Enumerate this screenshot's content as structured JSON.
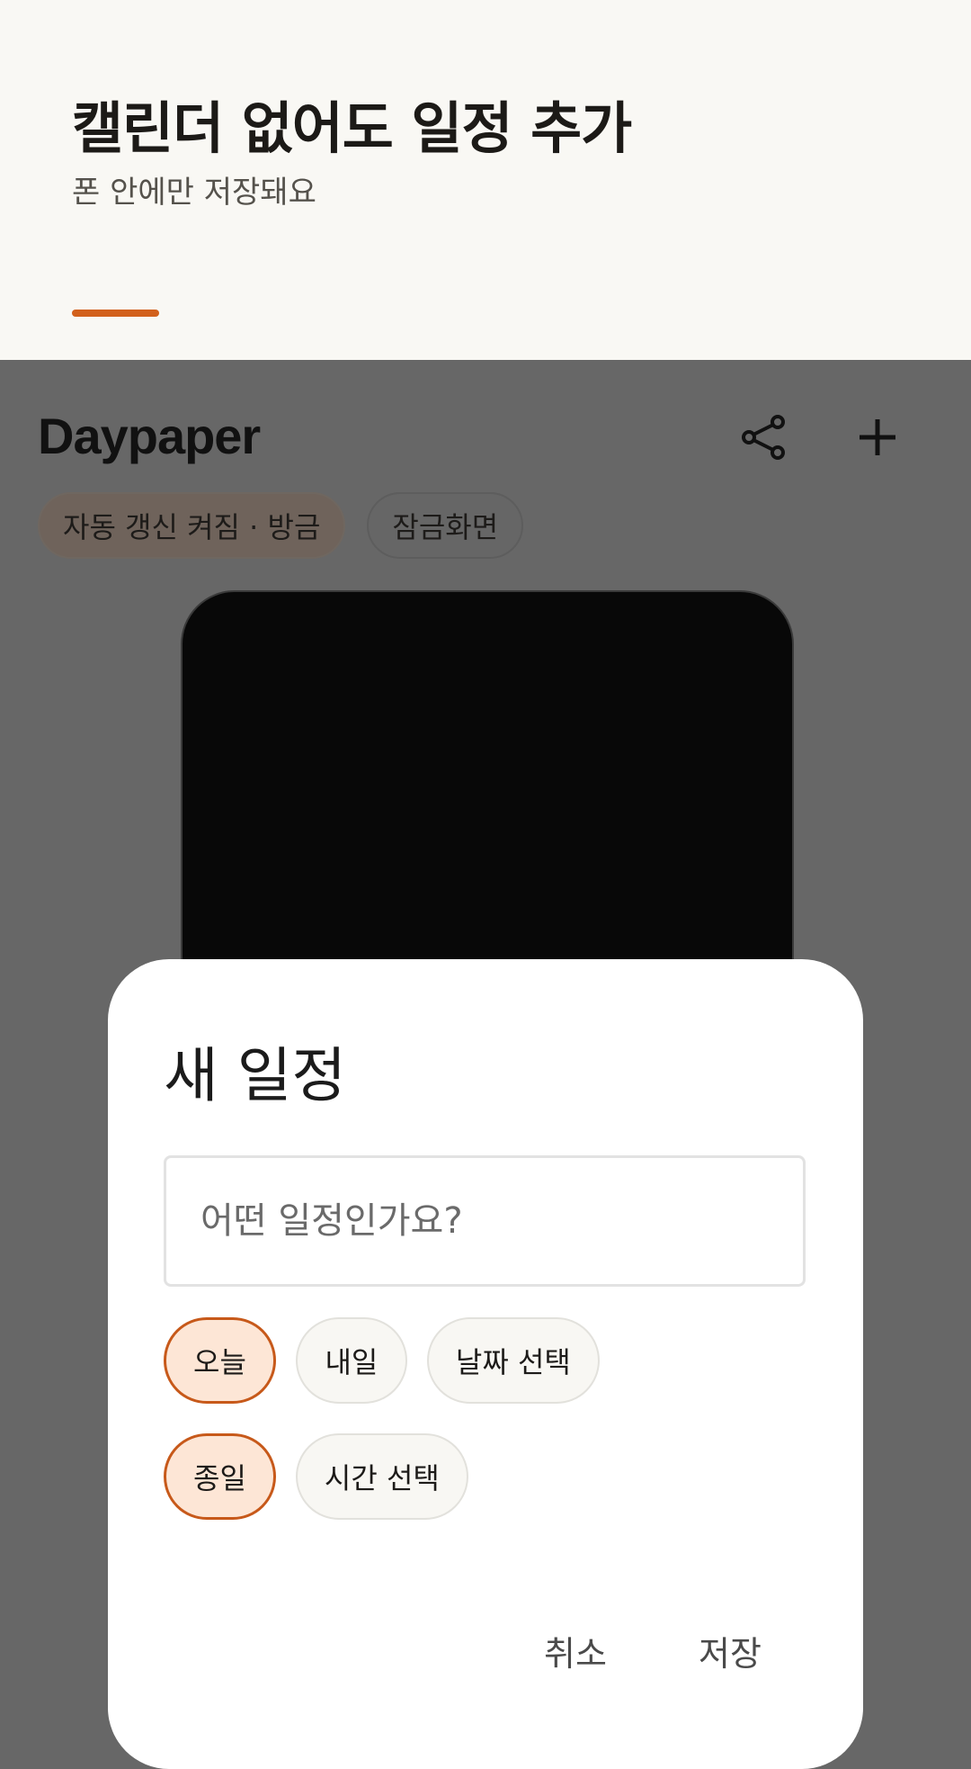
{
  "banner": {
    "title": "캘린더 없어도 일정 추가",
    "subtitle": "폰 안에만 저장돼요"
  },
  "app": {
    "title": "Daypaper",
    "chips": {
      "auto_refresh": "자동 갱신 켜짐 · 방금",
      "lock_screen": "잠금화면"
    },
    "icons": {
      "share": "share-icon",
      "add": "plus-icon"
    }
  },
  "dialog": {
    "title": "새 일정",
    "input_placeholder": "어떤 일정인가요?",
    "date_options": [
      "오늘",
      "내일",
      "날짜 선택"
    ],
    "time_options": [
      "종일",
      "시간 선택"
    ],
    "selected_date": "오늘",
    "selected_time": "종일",
    "cancel_label": "취소",
    "save_label": "저장"
  },
  "colors": {
    "accent": "#d2601b",
    "chip_selected_bg": "#fde6d6",
    "scrim": "#676767"
  }
}
